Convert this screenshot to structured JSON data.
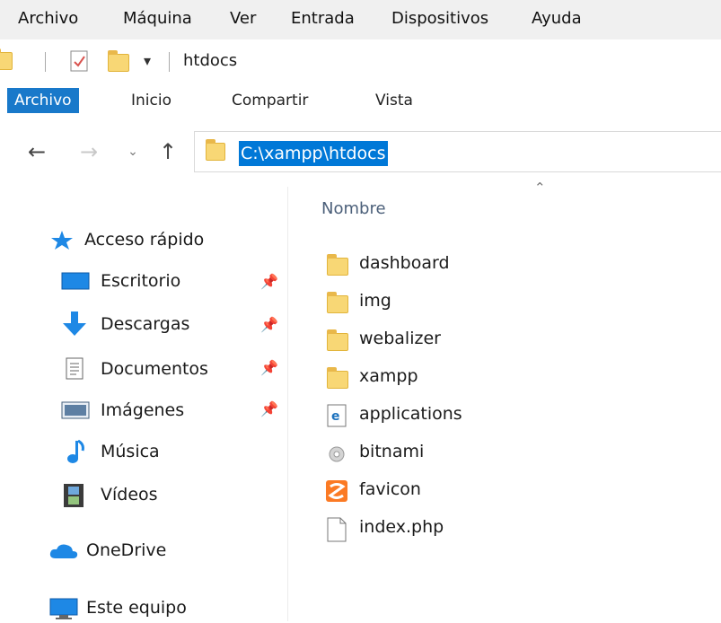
{
  "menubar": [
    "Archivo",
    "Máquina",
    "Ver",
    "Entrada",
    "Dispositivos",
    "Ayuda"
  ],
  "qat": {
    "title": "htdocs",
    "dropdown_glyph": "▾"
  },
  "ribbon": {
    "tabs": [
      "Archivo",
      "Inicio",
      "Compartir",
      "Vista"
    ],
    "active": 0
  },
  "address": {
    "path": "C:\\xampp\\htdocs"
  },
  "nav": {
    "quick_access": "Acceso rápido",
    "pinned": [
      "Escritorio",
      "Descargas",
      "Documentos",
      "Imágenes"
    ],
    "unpinned": [
      "Música",
      "Vídeos"
    ],
    "onedrive": "OneDrive",
    "this_pc": "Este equipo"
  },
  "files": {
    "column_header": "Nombre",
    "items": [
      {
        "name": "dashboard",
        "icon": "folder-icon"
      },
      {
        "name": "img",
        "icon": "folder-icon"
      },
      {
        "name": "webalizer",
        "icon": "folder-icon"
      },
      {
        "name": "xampp",
        "icon": "folder-icon"
      },
      {
        "name": "applications",
        "icon": "html-file-icon"
      },
      {
        "name": "bitnami",
        "icon": "settings-file-icon"
      },
      {
        "name": "favicon",
        "icon": "xampp-icon"
      },
      {
        "name": "index.php",
        "icon": "file-icon"
      }
    ]
  },
  "colors": {
    "accent": "#1979ca",
    "selection": "#0078d7",
    "folder": "#f8d775"
  }
}
